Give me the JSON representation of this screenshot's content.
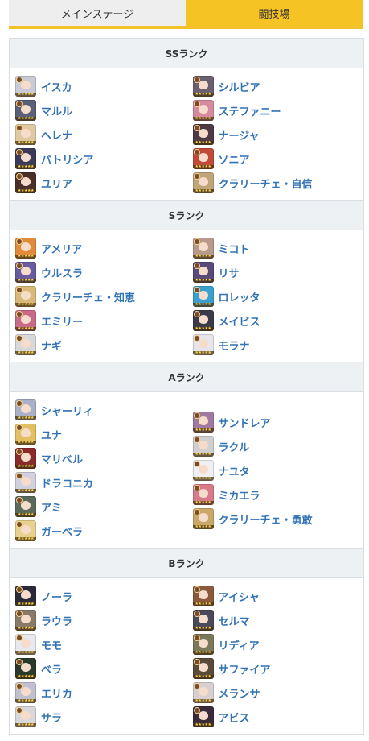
{
  "tabs": [
    {
      "label": "メインステージ",
      "active": false
    },
    {
      "label": "闘技場",
      "active": true
    }
  ],
  "colors": {
    "accent": "#f5c424",
    "link": "#3273b5",
    "header_bg": "#edf1f4",
    "border": "#d8dee4"
  },
  "tiers": [
    {
      "title": "SSランク",
      "left": [
        {
          "name": "イスカ",
          "hair": "#c9ccd6"
        },
        {
          "name": "マルル",
          "hair": "#5a5f7a"
        },
        {
          "name": "ヘレナ",
          "hair": "#e0c9a2"
        },
        {
          "name": "パトリシア",
          "hair": "#3b3a58"
        },
        {
          "name": "ユリア",
          "hair": "#4a2e2a"
        }
      ],
      "right": [
        {
          "name": "シルビア",
          "hair": "#6b6070"
        },
        {
          "name": "ステファニー",
          "hair": "#d68aa0"
        },
        {
          "name": "ナージャ",
          "hair": "#4e3a44"
        },
        {
          "name": "ソニア",
          "hair": "#c24a3a"
        },
        {
          "name": "クラリーチェ・自信",
          "hair": "#bfa57a"
        }
      ]
    },
    {
      "title": "Sランク",
      "left": [
        {
          "name": "アメリア",
          "hair": "#e08a3a"
        },
        {
          "name": "ウルスラ",
          "hair": "#6a5ba0"
        },
        {
          "name": "クラリーチェ・知恵",
          "hair": "#d9b97a"
        },
        {
          "name": "エミリー",
          "hair": "#c96a8a"
        },
        {
          "name": "ナギ",
          "hair": "#d8d8d8"
        }
      ],
      "right": [
        {
          "name": "ミコト",
          "hair": "#b89a8a"
        },
        {
          "name": "リサ",
          "hair": "#5a4a7a"
        },
        {
          "name": "ロレッタ",
          "hair": "#3aa0d0"
        },
        {
          "name": "メイビス",
          "hair": "#3a3a4a"
        },
        {
          "name": "モラナ",
          "hair": "#e6e6ea"
        }
      ]
    },
    {
      "title": "Aランク",
      "left": [
        {
          "name": "シャーリィ",
          "hair": "#aab0c8"
        },
        {
          "name": "ユナ",
          "hair": "#e0c060"
        },
        {
          "name": "マリベル",
          "hair": "#8a2a2a"
        },
        {
          "name": "ドラコニカ",
          "hair": "#d0d0e0"
        },
        {
          "name": "アミ",
          "hair": "#5a6a5a"
        },
        {
          "name": "ガーベラ",
          "hair": "#e8d090"
        }
      ],
      "right": [
        {
          "name": "サンドレア",
          "hair": "#a07aa0"
        },
        {
          "name": "ラクル",
          "hair": "#d0d0d0"
        },
        {
          "name": "ナユタ",
          "hair": "#f0f0f4"
        },
        {
          "name": "ミカエラ",
          "hair": "#d87a8a"
        },
        {
          "name": "クラリーチェ・勇敢",
          "hair": "#c9a86a"
        }
      ]
    },
    {
      "title": "Bランク",
      "left": [
        {
          "name": "ノーラ",
          "hair": "#2a2a3a"
        },
        {
          "name": "ラウラ",
          "hair": "#8a7a6a"
        },
        {
          "name": "モモ",
          "hair": "#e8e8ee"
        },
        {
          "name": "ベラ",
          "hair": "#2a3a2a"
        },
        {
          "name": "エリカ",
          "hair": "#c0c0d0"
        },
        {
          "name": "サラ",
          "hair": "#d8d8dc"
        }
      ],
      "right": [
        {
          "name": "アイシャ",
          "hair": "#8a5a3a"
        },
        {
          "name": "セルマ",
          "hair": "#4a4a5a"
        },
        {
          "name": "リディア",
          "hair": "#7a7a5a"
        },
        {
          "name": "サファイア",
          "hair": "#5a4a3a"
        },
        {
          "name": "メランサ",
          "hair": "#d8d0d0"
        },
        {
          "name": "アビス",
          "hair": "#3a2a3a"
        }
      ]
    }
  ]
}
